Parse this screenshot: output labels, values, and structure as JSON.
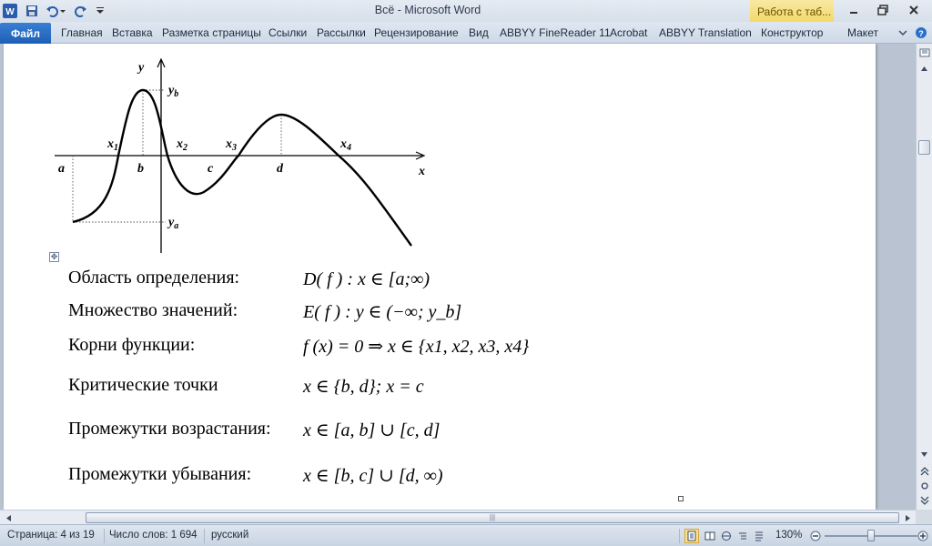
{
  "window": {
    "title": "Всё  -  Microsoft Word",
    "context_tab_title": "Работа с таб..."
  },
  "ribbon": {
    "file_tab": "Файл",
    "tabs": [
      "Главная",
      "Вставка",
      "Разметка страницы",
      "Ссылки",
      "Рассылки",
      "Рецензирование",
      "Вид",
      "ABBYY FineReader 11",
      "Acrobat",
      "ABBYY Translation",
      "Конструктор",
      "Макет"
    ]
  },
  "graph": {
    "labels": {
      "y_axis": "y",
      "x_axis": "x",
      "yb": "y",
      "yb_sub": "b",
      "ya": "y",
      "ya_sub": "a",
      "x1": "x",
      "x1_sub": "1",
      "x2": "x",
      "x2_sub": "2",
      "x3": "x",
      "x3_sub": "3",
      "x4": "x",
      "x4_sub": "4",
      "a": "a",
      "b": "b",
      "c": "c",
      "d": "d"
    }
  },
  "properties": [
    {
      "label": "Область определения:",
      "formula": "D( f ) : x ∈ [a;∞)"
    },
    {
      "label": "Множество значений:",
      "formula": "E( f ) : y ∈ (−∞; y_b]"
    },
    {
      "label": "Корни функции:",
      "formula": "f (x) = 0 ⇒ x ∈ {x1, x2, x3, x4}"
    },
    {
      "label": "Критические точки",
      "formula": "x ∈ {b, d};       x = c"
    },
    {
      "label": "Промежутки возрастания:",
      "formula": "x ∈ [a, b] ∪ [c, d]"
    },
    {
      "label": "Промежутки убывания:",
      "formula": "x ∈ [b, c] ∪ [d, ∞)"
    }
  ],
  "status": {
    "page": "Страница: 4 из 19",
    "words": "Число слов: 1 694",
    "language": "русский",
    "zoom": "130%"
  }
}
